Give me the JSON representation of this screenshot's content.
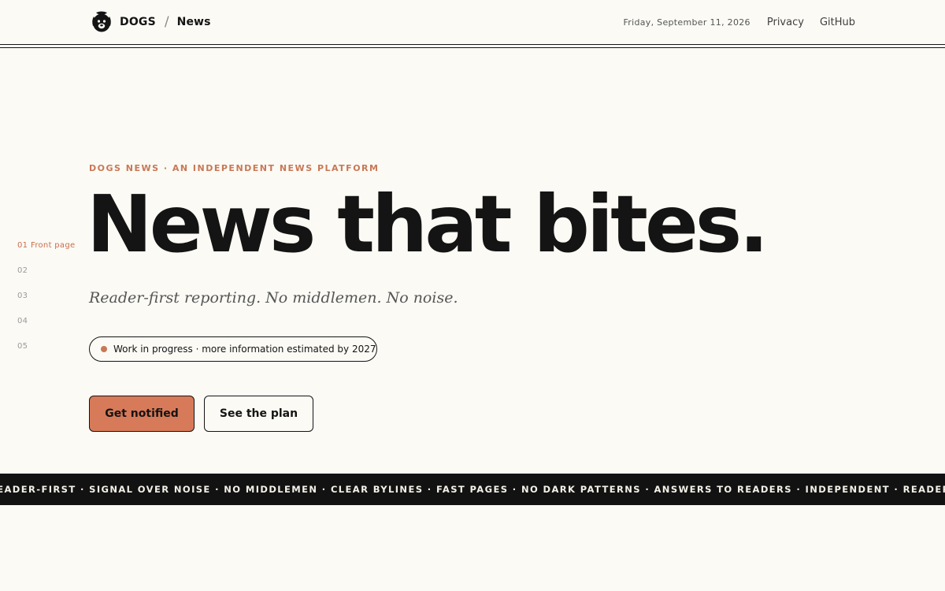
{
  "header": {
    "brand": "DOGS",
    "separator": "/",
    "section": "News",
    "date": "Friday, September 11, 2026",
    "links": [
      "Privacy",
      "GitHub"
    ]
  },
  "sidenav": {
    "items": [
      {
        "num": "01",
        "label": "Front page",
        "active": true
      },
      {
        "num": "02",
        "label": ""
      },
      {
        "num": "03",
        "label": ""
      },
      {
        "num": "04",
        "label": ""
      },
      {
        "num": "05",
        "label": ""
      }
    ]
  },
  "hero": {
    "eyebrow": "DOGS NEWS · AN INDEPENDENT NEWS PLATFORM",
    "headline": "News that bites.",
    "tagline": "Reader-first reporting. No middlemen. No noise.",
    "status": "Work in progress · more information estimated by 2027",
    "primary_cta": "Get notified",
    "secondary_cta": "See the plan"
  },
  "ticker": {
    "text": "READER-FIRST · SIGNAL OVER NOISE · NO MIDDLEMEN · CLEAR BYLINES · FAST PAGES · NO DARK PATTERNS · ANSWERS TO READERS ·  INDEPENDENT · READER-FIRST · SIGNAL OVER NOISE"
  },
  "colors": {
    "accent": "#d77a59",
    "accent_text": "#c97855",
    "ink": "#141414",
    "paper": "#fbfaf5"
  },
  "icons": {
    "logo": "dog-head-logo-icon",
    "status": "status-dot-icon"
  }
}
